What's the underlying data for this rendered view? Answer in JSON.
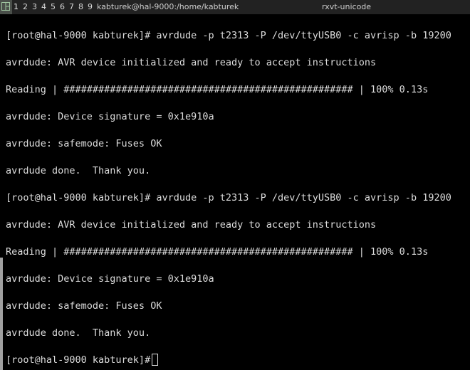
{
  "titlebar": {
    "tags": [
      "1",
      "2",
      "3",
      "4",
      "5",
      "6",
      "7",
      "8",
      "9"
    ],
    "window_title": "kabturek@hal-9000:/home/kabturek",
    "window_class": "rxvt-unicode"
  },
  "terminal": {
    "lines": [
      "[root@hal-9000 kabturek]# avrdude -p t2313 -P /dev/ttyUSB0 -c avrisp -b 19200",
      "avrdude: AVR device initialized and ready to accept instructions",
      "Reading | ################################################## | 100% 0.13s",
      "avrdude: Device signature = 0x1e910a",
      "avrdude: safemode: Fuses OK",
      "avrdude done.  Thank you.",
      "[root@hal-9000 kabturek]# avrdude -p t2313 -P /dev/ttyUSB0 -c avrisp -b 19200",
      "avrdude: AVR device initialized and ready to accept instructions",
      "Reading | ################################################## | 100% 0.13s",
      "avrdude: Device signature = 0x1e910a",
      "avrdude: safemode: Fuses OK",
      "avrdude done.  Thank you."
    ],
    "prompt": "[root@hal-9000 kabturek]#"
  }
}
